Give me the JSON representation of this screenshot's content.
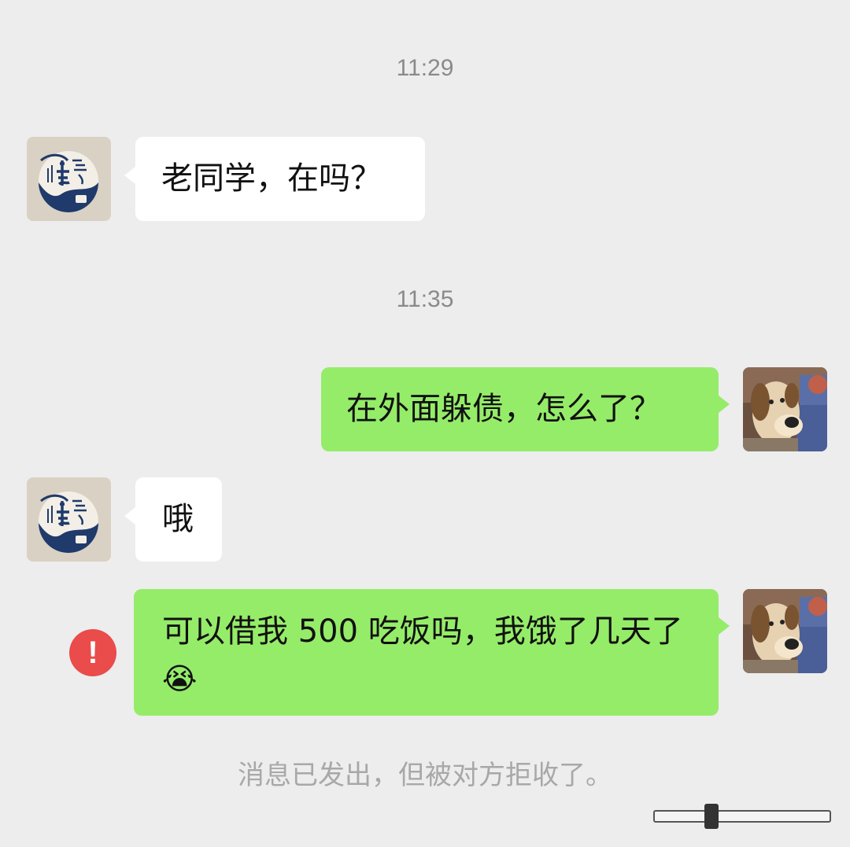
{
  "chat": {
    "timestamps": [
      "11:29",
      "11:35"
    ],
    "messages": [
      {
        "sender": "friend",
        "text": "老同学，在吗？"
      },
      {
        "sender": "me",
        "text": "在外面躲债，怎么了？"
      },
      {
        "sender": "friend",
        "text": "哦"
      },
      {
        "sender": "me",
        "text": "可以借我 500 吃饭吗，我饿了几天了",
        "emoji": "😭",
        "status": "failed"
      }
    ],
    "error_icon": "!",
    "system_note": "消息已发出，但被对方拒收了。"
  },
  "colors": {
    "incoming_bubble": "#ffffff",
    "outgoing_bubble": "#95ec69",
    "background": "#ededed",
    "error": "#ea4b4b"
  },
  "icons": {
    "friend_avatar": "calligraphy-seal-avatar",
    "my_avatar": "cartoon-dog-avatar",
    "failed_indicator": "exclamation-circle-icon"
  }
}
